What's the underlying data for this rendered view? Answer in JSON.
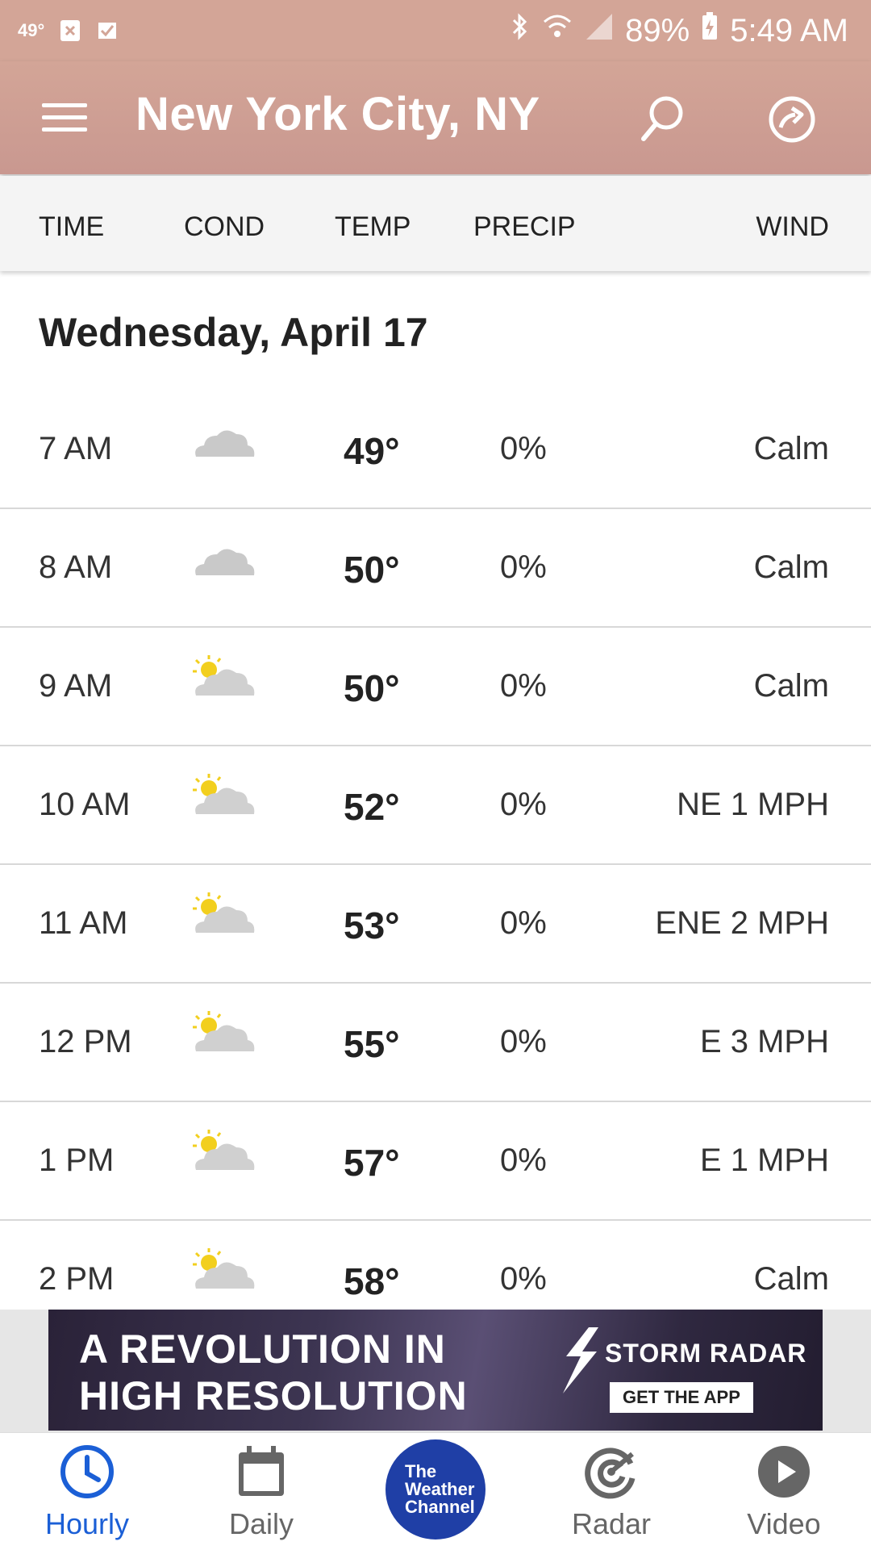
{
  "status_bar": {
    "temp": "49°",
    "battery": "89%",
    "time": "5:49 AM"
  },
  "app_bar": {
    "title": "New York City, NY"
  },
  "columns": {
    "time": "TIME",
    "cond": "COND",
    "temp": "TEMP",
    "precip": "PRECIP",
    "wind": "WIND"
  },
  "day_title": "Wednesday, April 17",
  "rows": [
    {
      "time": "7 AM",
      "cond": "cloudy",
      "temp": "49°",
      "precip": "0%",
      "wind": "Calm"
    },
    {
      "time": "8 AM",
      "cond": "cloudy",
      "temp": "50°",
      "precip": "0%",
      "wind": "Calm"
    },
    {
      "time": "9 AM",
      "cond": "partly-cloudy",
      "temp": "50°",
      "precip": "0%",
      "wind": "Calm"
    },
    {
      "time": "10 AM",
      "cond": "partly-cloudy",
      "temp": "52°",
      "precip": "0%",
      "wind": "NE 1 MPH"
    },
    {
      "time": "11 AM",
      "cond": "partly-cloudy",
      "temp": "53°",
      "precip": "0%",
      "wind": "ENE 2 MPH"
    },
    {
      "time": "12 PM",
      "cond": "partly-cloudy",
      "temp": "55°",
      "precip": "0%",
      "wind": "E 3 MPH"
    },
    {
      "time": "1 PM",
      "cond": "partly-cloudy",
      "temp": "57°",
      "precip": "0%",
      "wind": "E 1 MPH"
    },
    {
      "time": "2 PM",
      "cond": "partly-cloudy",
      "temp": "58°",
      "precip": "0%",
      "wind": "Calm"
    }
  ],
  "ad": {
    "line1": "A REVOLUTION IN",
    "line2": "HIGH RESOLUTION",
    "brand": "STORM RADAR",
    "cta": "GET THE APP"
  },
  "bottom_nav": {
    "hourly": "Hourly",
    "daily": "Daily",
    "logo_line1": "The",
    "logo_line2": "Weather",
    "logo_line3": "Channel",
    "radar": "Radar",
    "video": "Video"
  },
  "colors": {
    "header": "#d3a597",
    "active_tab": "#1b5fd6",
    "logo": "#1f3fa6"
  }
}
